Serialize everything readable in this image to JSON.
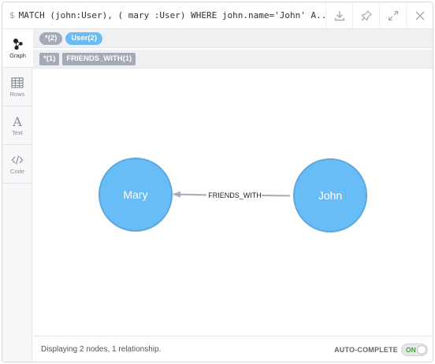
{
  "query": {
    "prompt": "$",
    "text": "MATCH (john:User), ( mary :User) WHERE john.name='John' A..."
  },
  "header_buttons": [
    {
      "name": "download-icon"
    },
    {
      "name": "pin-icon"
    },
    {
      "name": "expand-icon"
    },
    {
      "name": "close-icon"
    }
  ],
  "sidebar": {
    "tabs": [
      {
        "label": "Graph",
        "icon": "graph-icon",
        "active": true
      },
      {
        "label": "Rows",
        "icon": "table-icon",
        "active": false
      },
      {
        "label": "Text",
        "icon": "text-icon",
        "active": false
      },
      {
        "label": "Code",
        "icon": "code-icon",
        "active": false
      }
    ]
  },
  "node_labels": {
    "all": "*(2)",
    "user": "User(2)"
  },
  "relationship_types": {
    "all": "*(1)",
    "friends_with": "FRIENDS_WITH(1)"
  },
  "graph": {
    "nodes": [
      {
        "caption": "Mary",
        "color": "#68bdf6",
        "stroke": "#5ca8db"
      },
      {
        "caption": "John",
        "color": "#68bdf6",
        "stroke": "#5ca8db"
      }
    ],
    "relationship": {
      "caption": "FRIENDS_WITH",
      "color": "#a5abb6"
    }
  },
  "footer": {
    "status": "Displaying 2 nodes, 1 relationship.",
    "autocomplete_label": "AUTO-COMPLETE",
    "toggle_text": "ON"
  }
}
